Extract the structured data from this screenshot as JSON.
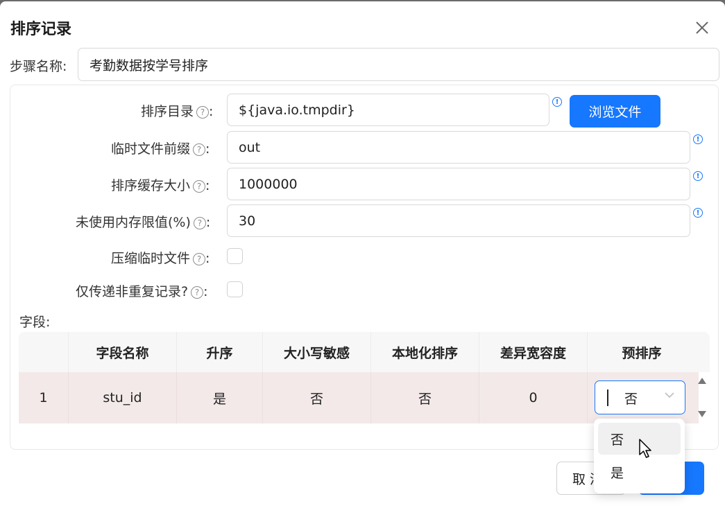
{
  "dialog": {
    "title": "排序记录",
    "step_name_label": "步骤名称:",
    "step_name_value": "考勤数据按学号排序"
  },
  "form": {
    "sort_dir_label": "排序目录",
    "sort_dir_value": "${java.io.tmpdir}",
    "browse_label": "浏览文件",
    "temp_prefix_label": "临时文件前缀",
    "temp_prefix_value": "out",
    "cache_size_label": "排序缓存大小",
    "cache_size_value": "1000000",
    "mem_limit_label": "未使用内存限值(%)",
    "mem_limit_value": "30",
    "compress_label": "压缩临时文件",
    "unique_label": "仅传递非重复记录?",
    "colon": ":"
  },
  "fields": {
    "label": "字段:",
    "columns": [
      "",
      "字段名称",
      "升序",
      "大小写敏感",
      "本地化排序",
      "差异宽容度",
      "预排序"
    ],
    "rows": [
      {
        "index": "1",
        "name": "stu_id",
        "asc": "是",
        "case": "否",
        "locale": "否",
        "tolerance": "0",
        "presort": "否"
      }
    ]
  },
  "dropdown": {
    "options": [
      "否",
      "是"
    ],
    "highlighted": "否"
  },
  "footer": {
    "cancel_label": "取 消"
  },
  "colors": {
    "primary": "#1677ff",
    "row_bg": "#f3e9e9"
  }
}
